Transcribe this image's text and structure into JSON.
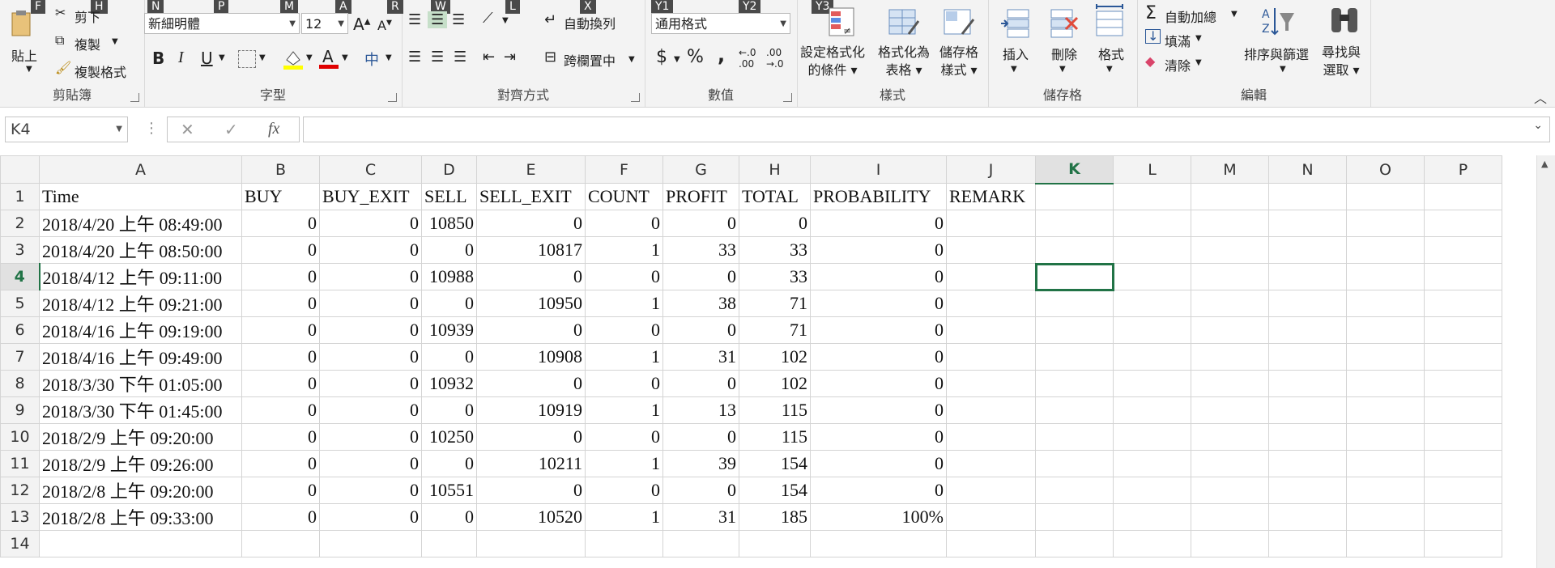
{
  "ribbon": {
    "keytips": [
      "F",
      "H",
      "N",
      "P",
      "M",
      "A",
      "R",
      "W",
      "L",
      "X",
      "Y1",
      "Y2",
      "Y3"
    ],
    "clipboard": {
      "label": "剪貼簿",
      "paste": "貼上",
      "cut": "剪下",
      "copy": "複製",
      "format_painter": "複製格式"
    },
    "font": {
      "label": "字型",
      "font_name": "新細明體",
      "font_size": "12",
      "bold": "B",
      "italic": "I",
      "underline": "U",
      "phonetic": "中"
    },
    "alignment": {
      "label": "對齊方式",
      "wrap_text": "自動換列",
      "merge_center": "跨欄置中"
    },
    "number": {
      "label": "數值",
      "format": "通用格式",
      "currency": "$",
      "percent": "%",
      "comma": ","
    },
    "styles": {
      "label": "樣式",
      "conditional": "設定格式化\n的條件",
      "format_table": "格式化為\n表格",
      "cell_styles": "儲存格\n樣式"
    },
    "cells": {
      "label": "儲存格",
      "insert": "插入",
      "delete": "刪除",
      "format": "格式"
    },
    "editing": {
      "label": "編輯",
      "autosum": "自動加總",
      "fill": "填滿",
      "clear": "清除",
      "sort_filter": "排序與篩選",
      "find_select": "尋找與\n選取"
    }
  },
  "formula_bar": {
    "name_box": "K4",
    "formula": ""
  },
  "sheet": {
    "columns": [
      "A",
      "B",
      "C",
      "D",
      "E",
      "F",
      "G",
      "H",
      "I",
      "J",
      "K",
      "L",
      "M",
      "N",
      "O",
      "P"
    ],
    "active_column": "K",
    "active_row": "4",
    "rows": [
      [
        "Time",
        "BUY",
        "BUY_EXIT",
        "SELL",
        "SELL_EXIT",
        "COUNT",
        "PROFIT",
        "TOTAL",
        "PROBABILITY",
        "REMARK",
        "",
        "",
        "",
        "",
        "",
        ""
      ],
      [
        "2018/4/20 上午 08:49:00",
        "0",
        "0",
        "10850",
        "0",
        "0",
        "0",
        "0",
        "0",
        "",
        "",
        "",
        "",
        "",
        "",
        ""
      ],
      [
        "2018/4/20 上午 08:50:00",
        "0",
        "0",
        "0",
        "10817",
        "1",
        "33",
        "33",
        "0",
        "",
        "",
        "",
        "",
        "",
        "",
        ""
      ],
      [
        "2018/4/12 上午 09:11:00",
        "0",
        "0",
        "10988",
        "0",
        "0",
        "0",
        "33",
        "0",
        "",
        "",
        "",
        "",
        "",
        "",
        ""
      ],
      [
        "2018/4/12 上午 09:21:00",
        "0",
        "0",
        "0",
        "10950",
        "1",
        "38",
        "71",
        "0",
        "",
        "",
        "",
        "",
        "",
        "",
        ""
      ],
      [
        "2018/4/16 上午 09:19:00",
        "0",
        "0",
        "10939",
        "0",
        "0",
        "0",
        "71",
        "0",
        "",
        "",
        "",
        "",
        "",
        "",
        ""
      ],
      [
        "2018/4/16 上午 09:49:00",
        "0",
        "0",
        "0",
        "10908",
        "1",
        "31",
        "102",
        "0",
        "",
        "",
        "",
        "",
        "",
        "",
        ""
      ],
      [
        "2018/3/30 下午 01:05:00",
        "0",
        "0",
        "10932",
        "0",
        "0",
        "0",
        "102",
        "0",
        "",
        "",
        "",
        "",
        "",
        "",
        ""
      ],
      [
        "2018/3/30 下午 01:45:00",
        "0",
        "0",
        "0",
        "10919",
        "1",
        "13",
        "115",
        "0",
        "",
        "",
        "",
        "",
        "",
        "",
        ""
      ],
      [
        "2018/2/9 上午 09:20:00",
        "0",
        "0",
        "10250",
        "0",
        "0",
        "0",
        "115",
        "0",
        "",
        "",
        "",
        "",
        "",
        "",
        ""
      ],
      [
        "2018/2/9 上午 09:26:00",
        "0",
        "0",
        "0",
        "10211",
        "1",
        "39",
        "154",
        "0",
        "",
        "",
        "",
        "",
        "",
        "",
        ""
      ],
      [
        "2018/2/8 上午 09:20:00",
        "0",
        "0",
        "10551",
        "0",
        "0",
        "0",
        "154",
        "0",
        "",
        "",
        "",
        "",
        "",
        "",
        ""
      ],
      [
        "2018/2/8 上午 09:33:00",
        "0",
        "0",
        "0",
        "10520",
        "1",
        "31",
        "185",
        "100%",
        "",
        "",
        "",
        "",
        "",
        "",
        ""
      ],
      [
        "",
        "",
        "",
        "",
        "",
        "",
        "",
        "",
        "",
        "",
        "",
        "",
        "",
        "",
        "",
        ""
      ]
    ],
    "row_numbers": [
      "1",
      "2",
      "3",
      "4",
      "5",
      "6",
      "7",
      "8",
      "9",
      "10",
      "11",
      "12",
      "13",
      "14"
    ]
  }
}
